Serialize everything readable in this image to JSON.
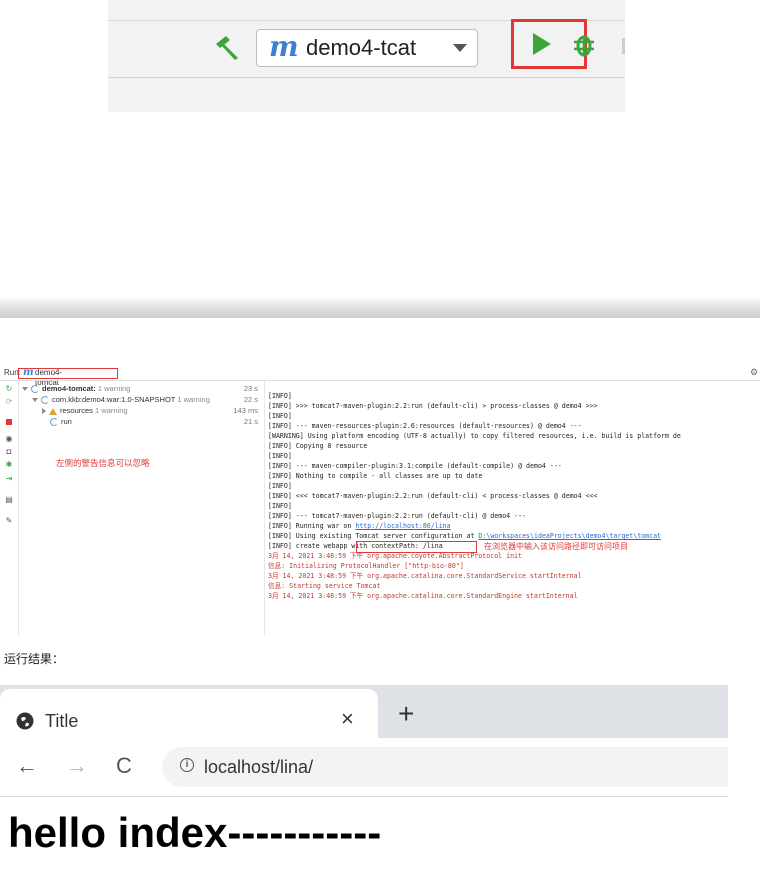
{
  "toolbar": {
    "config_name": "demo4-tcat",
    "m_glyph": "m"
  },
  "ide": {
    "run_label": "Run:",
    "tab_name": "demo4-tomcat",
    "tree": [
      {
        "name": "demo4-tomcat:",
        "note": "1 warning",
        "time": "23 s"
      },
      {
        "name": "com.kkb:demo4:war:1.0-SNAPSHOT",
        "note": "1 warning",
        "time": "22 s"
      },
      {
        "name": "resources",
        "note": "1 warning",
        "time": "143 ms"
      },
      {
        "name": "run",
        "note": "",
        "time": "21 s"
      }
    ],
    "left_annotation": "左侧的警告信息可以忽略",
    "console": [
      "[INFO]",
      "[INFO] >>> tomcat7-maven-plugin:2.2:run (default-cli) > process-classes @ demo4 >>>",
      "[INFO]",
      "[INFO] --- maven-resources-plugin:2.6:resources (default-resources) @ demo4 ---",
      "[WARNING] Using platform encoding (UTF-8 actually) to copy filtered resources, i.e. build is platform de",
      "[INFO] Copying 0 resource",
      "[INFO]",
      "[INFO] --- maven-compiler-plugin:3.1:compile (default-compile) @ demo4 ---",
      "[INFO] Nothing to compile - all classes are up to date",
      "[INFO]",
      "[INFO] <<< tomcat7-maven-plugin:2.2:run (default-cli) < process-classes @ demo4 <<<",
      "[INFO]",
      "[INFO] --- tomcat7-maven-plugin:2.2:run (default-cli) @ demo4 ---"
    ],
    "running_prefix": "[INFO] Running war on ",
    "running_url": "http://localhost:80/lina",
    "right_annotation": "在浏览器中输入该访问路径即可访问项目",
    "config_prefix": "[INFO] Using existing Tomcat server configuration at ",
    "config_path": "D:\\workspaces\\ideaProjects\\demo4\\target\\tomcat",
    "webapp_line": "[INFO] create webapp with contextPath: /lina",
    "red_lines": [
      "3月 14, 2021 3:48:59 下午 org.apache.coyote.AbstractProtocol init",
      "信息: Initializing ProtocolHandler [\"http-bio-80\"]",
      "3月 14, 2021 3:48:59 下午 org.apache.catalina.core.StandardService startInternal",
      "信息: Starting service Tomcat",
      "3月 14, 2021 3:48:59 下午 org.apache.catalina.core.StandardEngine startInternal"
    ]
  },
  "result_label": "运行结果：",
  "browser": {
    "tab_title": "Title",
    "close_glyph": "×",
    "newtab_glyph": "+",
    "back_glyph": "←",
    "fwd_glyph": "→",
    "reload_glyph": "C",
    "info_glyph": "i",
    "url": "localhost/lina/",
    "heading": "hello index-----------"
  }
}
